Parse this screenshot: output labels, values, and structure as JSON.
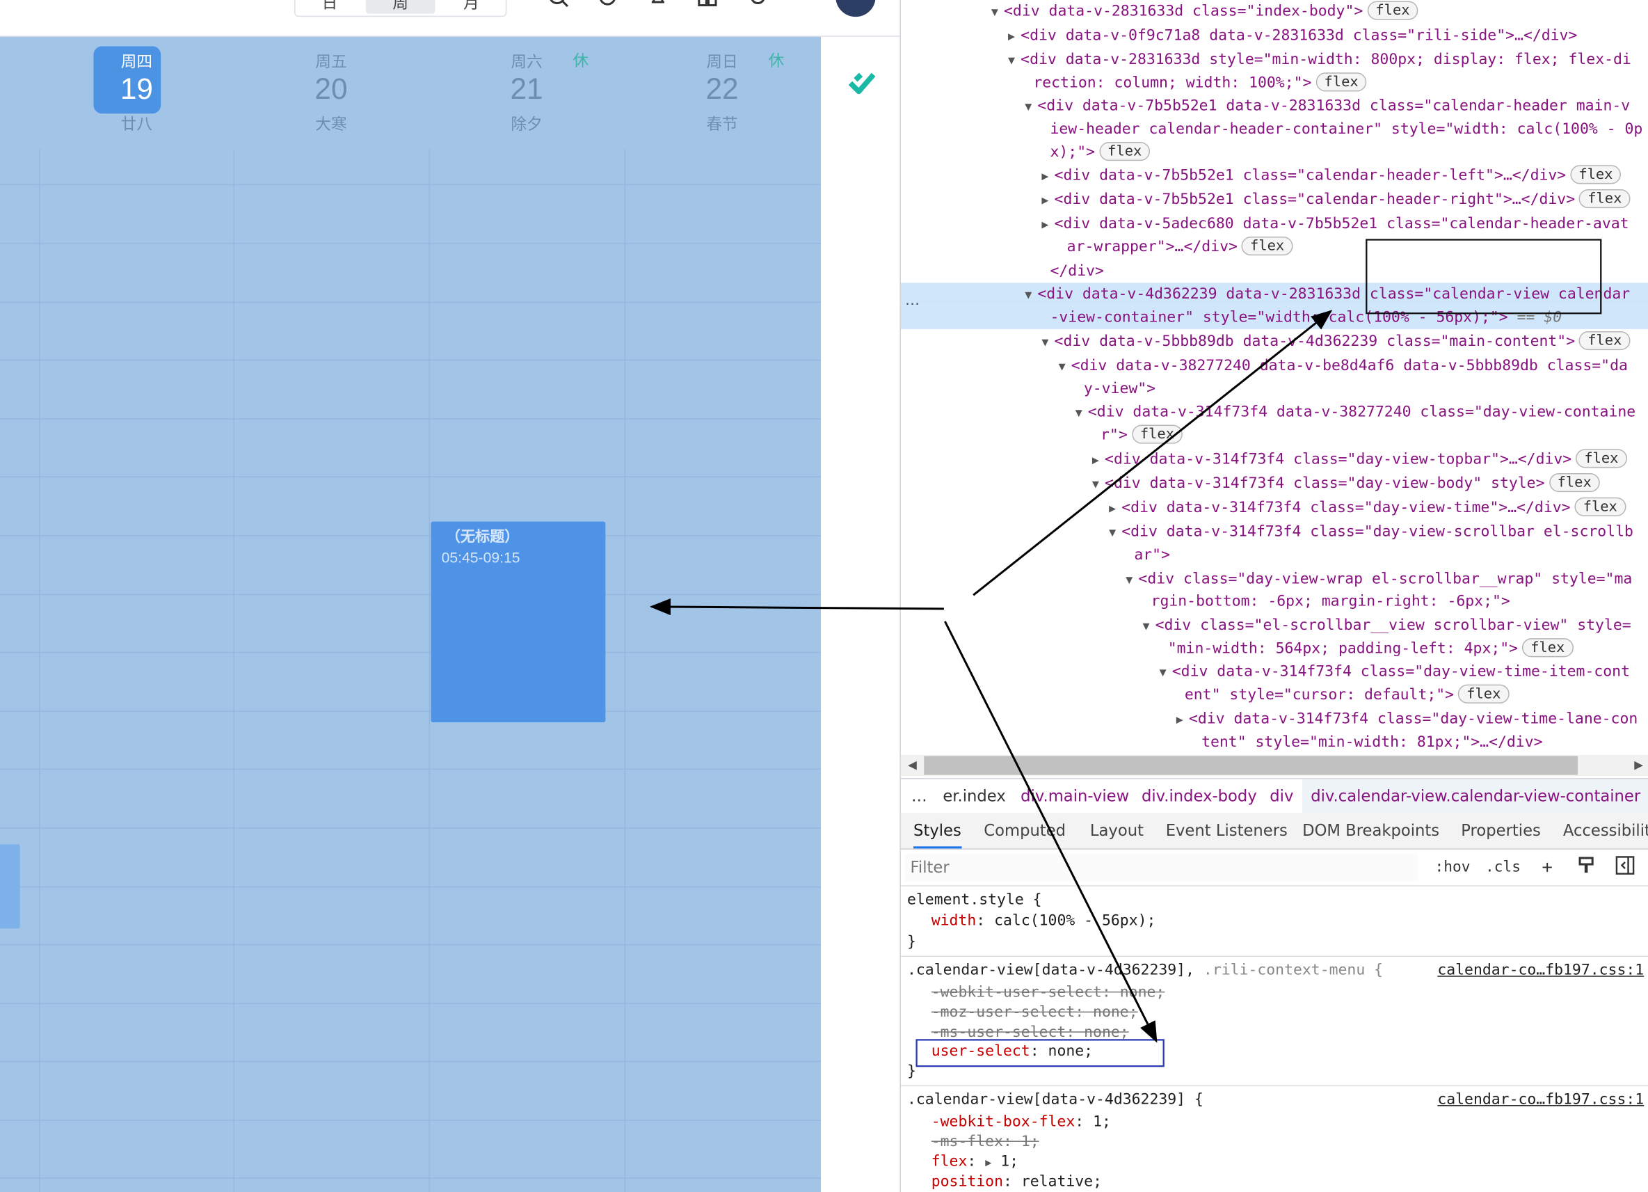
{
  "calendar": {
    "view_switch": [
      "日",
      "周",
      "月"
    ],
    "active_view": "周",
    "top_icons": [
      "search-icon",
      "refresh-icon",
      "bell-icon",
      "layout-icon",
      "gear-icon"
    ],
    "days": [
      {
        "weekday": "周四",
        "date": "19",
        "lunar": "廿八",
        "today": true,
        "rest": ""
      },
      {
        "weekday": "周五",
        "date": "20",
        "lunar": "大寒",
        "today": false,
        "rest": ""
      },
      {
        "weekday": "周六",
        "date": "21",
        "lunar": "除夕",
        "today": false,
        "rest": "休"
      },
      {
        "weekday": "周日",
        "date": "22",
        "lunar": "春节",
        "today": false,
        "rest": "休"
      }
    ],
    "event": {
      "title": "（无标题）",
      "time": "05:45-09:15"
    },
    "colors": {
      "overlay": "#a1c4e7",
      "today_badge": "#4c93e4",
      "event": "#4e93e6",
      "rest_tag": "#3fb5a8",
      "check": "#19b9a5"
    }
  },
  "devtools": {
    "dom_lines": [
      {
        "tri": "▼",
        "a": "<div data-v-2831633d class=\"index-body\">",
        "pill": "flex"
      },
      {
        "tri": "▶",
        "a": "<div data-v-0f9c71a8 data-v-2831633d class=\"rili-side\">…</div>",
        "pill": ""
      },
      {
        "tri": "▼",
        "a": "<div data-v-2831633d style=\"min-width: 800px; display: flex; flex-di",
        "pill": ""
      },
      {
        "tri": "",
        "a": "rection: column; width: 100%;\">",
        "pill": "flex"
      },
      {
        "tri": "▼",
        "a": "<div data-v-7b5b52e1 data-v-2831633d class=\"calendar-header main-v",
        "pill": ""
      },
      {
        "tri": "",
        "a": "iew-header calendar-header-container\" style=\"width: calc(100% - 0p",
        "pill": ""
      },
      {
        "tri": "",
        "a": "x);\">",
        "pill": "flex"
      },
      {
        "tri": "▶",
        "a": "<div data-v-7b5b52e1 class=\"calendar-header-left\">…</div>",
        "pill": "flex"
      },
      {
        "tri": "▶",
        "a": "<div data-v-7b5b52e1 class=\"calendar-header-right\">…</div>",
        "pill": "flex"
      },
      {
        "tri": "▶",
        "a": "<div data-v-5adec680 data-v-7b5b52e1 class=\"calendar-header-avat",
        "pill": ""
      },
      {
        "tri": "",
        "a": "ar-wrapper\">…</div>",
        "pill": "flex"
      },
      {
        "tri": "",
        "a": "</div>",
        "pill": ""
      },
      {
        "tri": "▼",
        "a": "<div data-v-4d362239 data-v-2831633d class=\"calendar-view calendar",
        "pill": "",
        "selected": true
      },
      {
        "tri": "",
        "a": "-view-container\" style=\"width: calc(100% - 56px);\">",
        "pill": "",
        "eq": "== $0",
        "selected": true
      },
      {
        "tri": "▼",
        "a": "<div data-v-5bbb89db data-v-4d362239 class=\"main-content\">",
        "pill": "flex"
      },
      {
        "tri": "▼",
        "a": "<div data-v-38277240 data-v-be8d4af6 data-v-5bbb89db class=\"da",
        "pill": ""
      },
      {
        "tri": "",
        "a": "y-view\">",
        "pill": ""
      },
      {
        "tri": "▼",
        "a": "<div data-v-314f73f4 data-v-38277240 class=\"day-view-containe",
        "pill": ""
      },
      {
        "tri": "",
        "a": "r\">",
        "pill": "flex"
      },
      {
        "tri": "▶",
        "a": "<div data-v-314f73f4 class=\"day-view-topbar\">…</div>",
        "pill": "flex"
      },
      {
        "tri": "▼",
        "a": "<div data-v-314f73f4 class=\"day-view-body\" style>",
        "pill": "flex"
      },
      {
        "tri": "▶",
        "a": "<div data-v-314f73f4 class=\"day-view-time\">…</div>",
        "pill": "flex"
      },
      {
        "tri": "▼",
        "a": "<div data-v-314f73f4 class=\"day-view-scrollbar el-scrollb",
        "pill": ""
      },
      {
        "tri": "",
        "a": "ar\">",
        "pill": ""
      },
      {
        "tri": "▼",
        "a": "<div class=\"day-view-wrap el-scrollbar__wrap\" style=\"ma",
        "pill": ""
      },
      {
        "tri": "",
        "a": "rgin-bottom: -6px; margin-right: -6px;\">",
        "pill": ""
      },
      {
        "tri": "▼",
        "a": "<div class=\"el-scrollbar__view scrollbar-view\" style=",
        "pill": ""
      },
      {
        "tri": "",
        "a": "\"min-width: 564px; padding-left: 4px;\">",
        "pill": "flex"
      },
      {
        "tri": "▼",
        "a": "<div data-v-314f73f4 class=\"day-view-time-item-cont",
        "pill": ""
      },
      {
        "tri": "",
        "a": "ent\" style=\"cursor: default;\">",
        "pill": "flex"
      },
      {
        "tri": "▶",
        "a": "<div data-v-314f73f4 class=\"day-view-time-lane-con",
        "pill": ""
      },
      {
        "tri": "",
        "a": "tent\" style=\"min-width: 81px;\">…</div>",
        "pill": ""
      }
    ],
    "dots": "…",
    "breadcrumbs": [
      "er.index",
      "div.main-view",
      "div.index-body",
      "div",
      "div.calendar-view.calendar-view-container"
    ],
    "breadcrumb_more": "…",
    "tabs": [
      "Styles",
      "Computed",
      "Layout",
      "Event Listeners",
      "DOM Breakpoints",
      "Properties",
      "Accessibility"
    ],
    "active_tab": "Styles",
    "filter_placeholder": "Filter",
    "filter_buttons": [
      ":hov",
      ".cls"
    ],
    "filter_icons": [
      "plus-icon",
      "paint-icon",
      "sidebar-toggle-icon"
    ],
    "rules": {
      "element_style": {
        "selector": "element.style {",
        "prop": "width",
        "value": "calc(100% - 56px);",
        "close": "}"
      },
      "rule1": {
        "selector": ".calendar-view[data-v-4d362239],",
        "selector_dim": ".rili-context-menu {",
        "source": "calendar-co…fb197.css:1",
        "struck": [
          "-webkit-user-select: none;",
          "-moz-user-select: none;",
          "-ms-user-select: none;"
        ],
        "prop": "user-select",
        "value": "none;",
        "close": "}"
      },
      "rule2": {
        "selector": ".calendar-view[data-v-4d362239] {",
        "source": "calendar-co…fb197.css:1",
        "lines": [
          {
            "prop": "-webkit-box-flex",
            "value": "1;",
            "struck": false
          },
          {
            "prop": "-ms-flex",
            "value": "1;",
            "struck": true
          },
          {
            "prop": "flex",
            "value": "1;",
            "struck": false,
            "expand": true
          },
          {
            "prop": "position",
            "value": "relative;",
            "struck": false
          }
        ]
      }
    }
  }
}
